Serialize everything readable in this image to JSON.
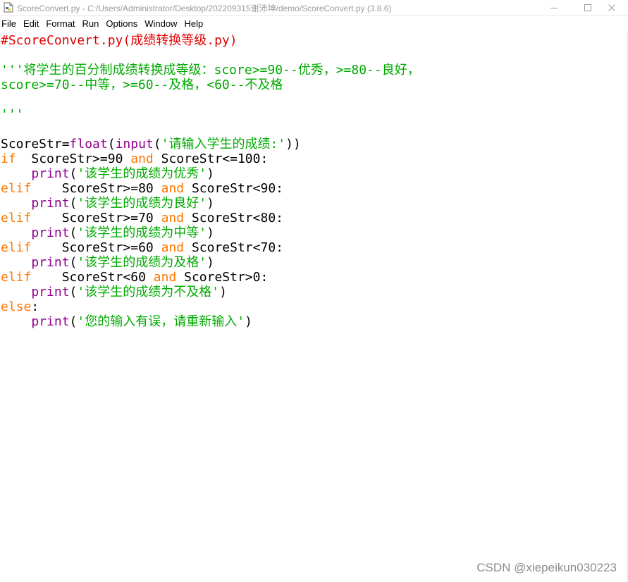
{
  "window": {
    "title": "ScoreConvert.py - C:/Users/Administrator/Desktop/202209315谢沛坤/demo/ScoreConvert.py (3.8.6)"
  },
  "menu": {
    "items": [
      {
        "label": "File"
      },
      {
        "label": "Edit"
      },
      {
        "label": "Format"
      },
      {
        "label": "Run"
      },
      {
        "label": "Options"
      },
      {
        "label": "Window"
      },
      {
        "label": "Help"
      }
    ]
  },
  "colors": {
    "comment": "#dd0000",
    "string": "#00aa00",
    "keyword": "#ff7700",
    "builtin": "#900090",
    "default": "#000000"
  },
  "icons": {
    "app": "idle-python-file-icon",
    "minimize": "minimize-icon",
    "maximize": "maximize-icon",
    "close": "close-icon"
  },
  "editor": {
    "lines": [
      [
        {
          "t": "#ScoreConvert.py(成绩转换等级.py)",
          "k": "comment"
        }
      ],
      [],
      [
        {
          "t": "'''将学生的百分制成绩转换成等级：score>=90--优秀，>=80--良好，",
          "k": "string"
        }
      ],
      [
        {
          "t": "score>=70--中等，>=60--及格，<60--不及格",
          "k": "string"
        }
      ],
      [],
      [
        {
          "t": "'''",
          "k": "string"
        }
      ],
      [],
      [
        {
          "t": "ScoreStr=",
          "k": "default"
        },
        {
          "t": "float",
          "k": "builtin"
        },
        {
          "t": "(",
          "k": "default"
        },
        {
          "t": "input",
          "k": "builtin"
        },
        {
          "t": "(",
          "k": "default"
        },
        {
          "t": "'请输入学生的成绩:'",
          "k": "string"
        },
        {
          "t": "))",
          "k": "default"
        }
      ],
      [
        {
          "t": "if",
          "k": "keyword"
        },
        {
          "t": "  ScoreStr>=90 ",
          "k": "default"
        },
        {
          "t": "and",
          "k": "keyword"
        },
        {
          "t": " ScoreStr<=100:",
          "k": "default"
        }
      ],
      [
        {
          "t": "    ",
          "k": "default"
        },
        {
          "t": "print",
          "k": "builtin"
        },
        {
          "t": "(",
          "k": "default"
        },
        {
          "t": "'该学生的成绩为优秀'",
          "k": "string"
        },
        {
          "t": ")",
          "k": "default"
        }
      ],
      [
        {
          "t": "elif",
          "k": "keyword"
        },
        {
          "t": "    ScoreStr>=80 ",
          "k": "default"
        },
        {
          "t": "and",
          "k": "keyword"
        },
        {
          "t": " ScoreStr<90:",
          "k": "default"
        }
      ],
      [
        {
          "t": "    ",
          "k": "default"
        },
        {
          "t": "print",
          "k": "builtin"
        },
        {
          "t": "(",
          "k": "default"
        },
        {
          "t": "'该学生的成绩为良好'",
          "k": "string"
        },
        {
          "t": ")",
          "k": "default"
        }
      ],
      [
        {
          "t": "elif",
          "k": "keyword"
        },
        {
          "t": "    ScoreStr>=70 ",
          "k": "default"
        },
        {
          "t": "and",
          "k": "keyword"
        },
        {
          "t": " ScoreStr<80:",
          "k": "default"
        }
      ],
      [
        {
          "t": "    ",
          "k": "default"
        },
        {
          "t": "print",
          "k": "builtin"
        },
        {
          "t": "(",
          "k": "default"
        },
        {
          "t": "'该学生的成绩为中等'",
          "k": "string"
        },
        {
          "t": ")",
          "k": "default"
        }
      ],
      [
        {
          "t": "elif",
          "k": "keyword"
        },
        {
          "t": "    ScoreStr>=60 ",
          "k": "default"
        },
        {
          "t": "and",
          "k": "keyword"
        },
        {
          "t": " ScoreStr<70:",
          "k": "default"
        }
      ],
      [
        {
          "t": "    ",
          "k": "default"
        },
        {
          "t": "print",
          "k": "builtin"
        },
        {
          "t": "(",
          "k": "default"
        },
        {
          "t": "'该学生的成绩为及格'",
          "k": "string"
        },
        {
          "t": ")",
          "k": "default"
        }
      ],
      [
        {
          "t": "elif",
          "k": "keyword"
        },
        {
          "t": "    ScoreStr<60 ",
          "k": "default"
        },
        {
          "t": "and",
          "k": "keyword"
        },
        {
          "t": " ScoreStr>0:",
          "k": "default"
        }
      ],
      [
        {
          "t": "    ",
          "k": "default"
        },
        {
          "t": "print",
          "k": "builtin"
        },
        {
          "t": "(",
          "k": "default"
        },
        {
          "t": "'该学生的成绩为不及格'",
          "k": "string"
        },
        {
          "t": ")",
          "k": "default"
        }
      ],
      [
        {
          "t": "else",
          "k": "keyword"
        },
        {
          "t": ":",
          "k": "default"
        }
      ],
      [
        {
          "t": "    ",
          "k": "default"
        },
        {
          "t": "print",
          "k": "builtin"
        },
        {
          "t": "(",
          "k": "default"
        },
        {
          "t": "'您的输入有误，请重新输入'",
          "k": "string"
        },
        {
          "t": ")",
          "k": "default"
        }
      ]
    ]
  },
  "watermark": {
    "text": "CSDN @xiepeikun030223"
  }
}
